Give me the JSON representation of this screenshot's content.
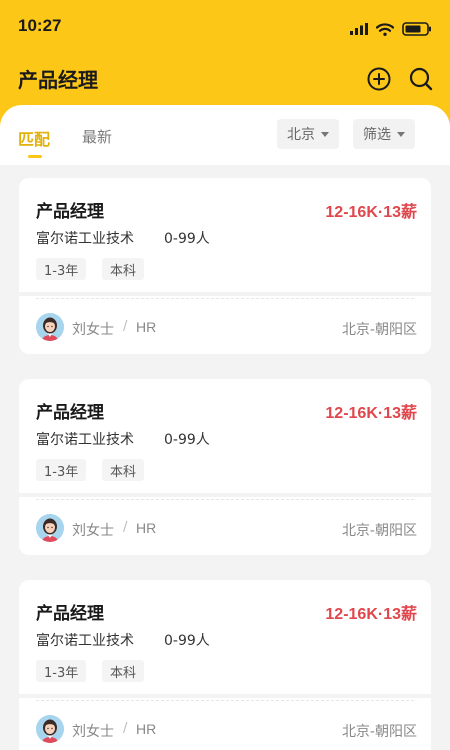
{
  "status_bar": {
    "time": "10:27"
  },
  "header": {
    "title": "产品经理",
    "add_icon": "plus-circle-icon",
    "search_icon": "search-icon"
  },
  "tabs": [
    {
      "label": "匹配",
      "active": true
    },
    {
      "label": "最新",
      "active": false
    }
  ],
  "filters": {
    "city": "北京",
    "filter": "筛选"
  },
  "colors": {
    "brand": "#fdc718",
    "salary": "#e0474c"
  },
  "jobs": [
    {
      "title": "产品经理",
      "salary": "12-16K·13薪",
      "company": "富尔诺工业技术",
      "size": "0-99人",
      "tags": [
        "1-3年",
        "本科"
      ],
      "hr_name": "刘女士",
      "hr_sep": "/",
      "hr_role": "HR",
      "location": "北京-朝阳区"
    },
    {
      "title": "产品经理",
      "salary": "12-16K·13薪",
      "company": "富尔诺工业技术",
      "size": "0-99人",
      "tags": [
        "1-3年",
        "本科"
      ],
      "hr_name": "刘女士",
      "hr_sep": "/",
      "hr_role": "HR",
      "location": "北京-朝阳区"
    },
    {
      "title": "产品经理",
      "salary": "12-16K·13薪",
      "company": "富尔诺工业技术",
      "size": "0-99人",
      "tags": [
        "1-3年",
        "本科"
      ],
      "hr_name": "刘女士",
      "hr_sep": "/",
      "hr_role": "HR",
      "location": "北京-朝阳区"
    }
  ]
}
